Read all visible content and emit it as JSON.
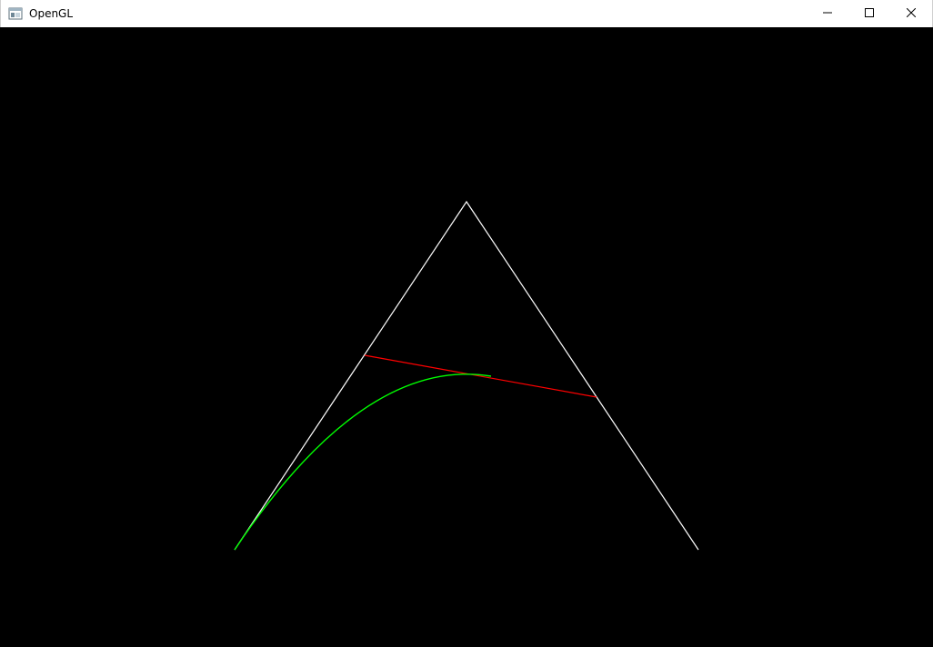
{
  "window": {
    "title": "OpenGL",
    "title_icon": "opengl-window-icon"
  },
  "controls": {
    "minimize_icon": "minimize-icon",
    "maximize_icon": "maximize-icon",
    "close_icon": "close-icon"
  },
  "scene": {
    "background": "#000000",
    "control_polygon_color": "#ffffff",
    "tangent_line_color": "#ff0000",
    "curve_color": "#00ff00"
  }
}
